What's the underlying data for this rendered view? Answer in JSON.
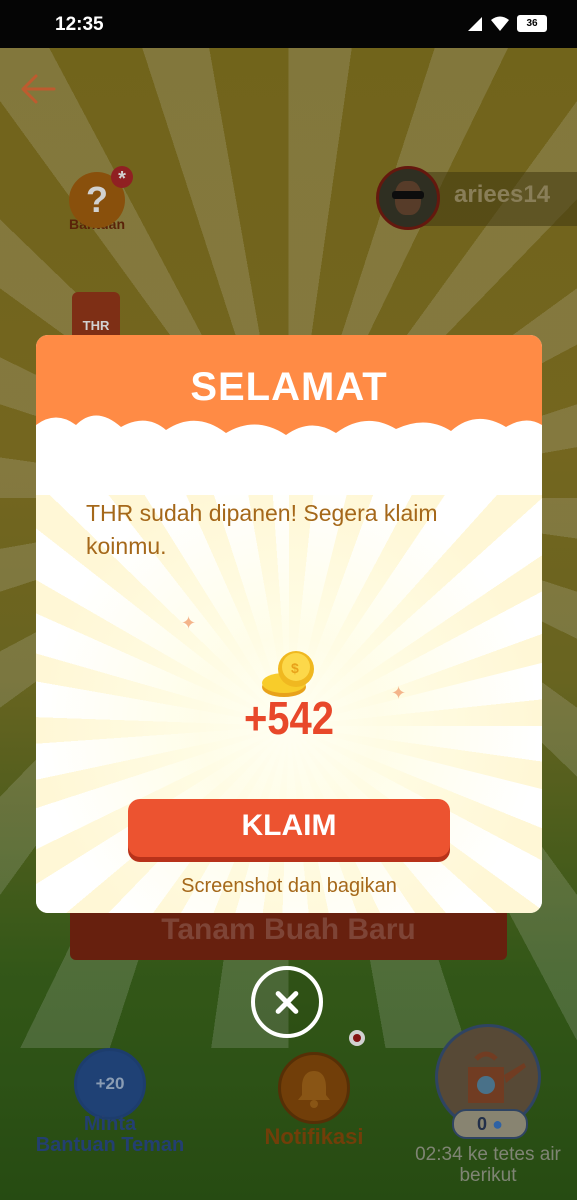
{
  "status_bar": {
    "time": "12:35",
    "battery": "36"
  },
  "header": {
    "username": "ariees14"
  },
  "help": {
    "label": "Bantuan",
    "glyph": "?"
  },
  "thr_badge": {
    "label": "THR"
  },
  "background": {
    "plant_button_label": "Tanam Buah Baru"
  },
  "bottom_bar": {
    "ask_help": {
      "badge": "+20",
      "label_line1": "Minta",
      "label_line2": "Bantuan Teman"
    },
    "notifications": {
      "label": "Notifikasi"
    },
    "water": {
      "count": "0",
      "label_line1": "02:34 ke tetes air",
      "label_line2": "berikut"
    }
  },
  "modal": {
    "title": "SELAMAT",
    "message": "THR sudah dipanen! Segera klaim koinmu.",
    "amount": "+542",
    "claim_label": "KLAIM",
    "share_label": "Screenshot dan bagikan"
  },
  "colors": {
    "accent": "#ff8b45",
    "button": "#ec5330",
    "text": "#a5681a"
  }
}
